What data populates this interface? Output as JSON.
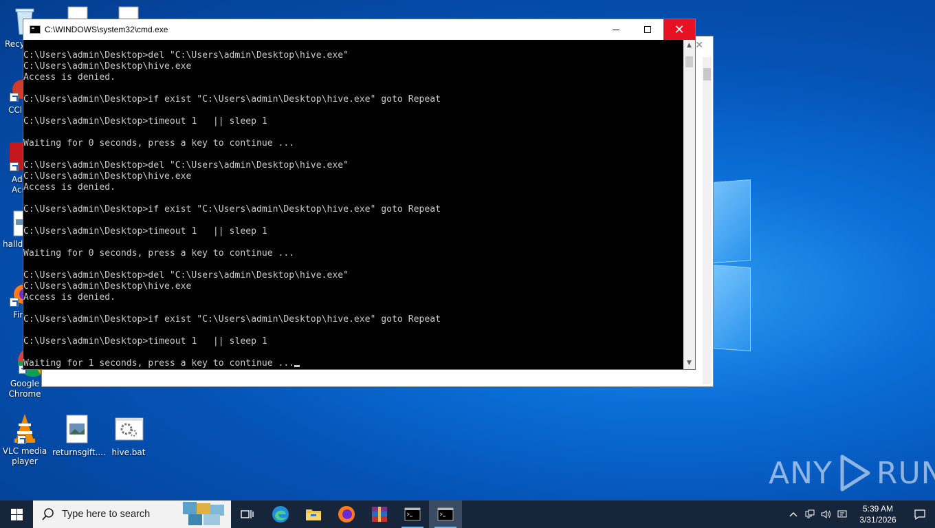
{
  "desktop": {
    "icons": [
      {
        "id": "recycle",
        "label": "Recy"
      },
      {
        "id": "ccleaner",
        "label": "CCl"
      },
      {
        "id": "acrobat",
        "label": "Ad\nAcr"
      },
      {
        "id": "halld",
        "label": "halld"
      },
      {
        "id": "firefox",
        "label": "Fir"
      },
      {
        "id": "chrome",
        "label": "Google\nChrome"
      },
      {
        "id": "vlc",
        "label": "VLC media\nplayer"
      },
      {
        "id": "returnsgift",
        "label": "returnsgift...."
      },
      {
        "id": "hivebat",
        "label": "hive.bat"
      }
    ]
  },
  "cmd": {
    "title": "C:\\WINDOWS\\system32\\cmd.exe",
    "lines": [
      "C:\\Users\\admin\\Desktop>del \"C:\\Users\\admin\\Desktop\\hive.exe\"",
      "C:\\Users\\admin\\Desktop\\hive.exe",
      "Access is denied.",
      "",
      "C:\\Users\\admin\\Desktop>if exist \"C:\\Users\\admin\\Desktop\\hive.exe\" goto Repeat",
      "",
      "C:\\Users\\admin\\Desktop>timeout 1   || sleep 1",
      "",
      "Waiting for 0 seconds, press a key to continue ...",
      "",
      "C:\\Users\\admin\\Desktop>del \"C:\\Users\\admin\\Desktop\\hive.exe\"",
      "C:\\Users\\admin\\Desktop\\hive.exe",
      "Access is denied.",
      "",
      "C:\\Users\\admin\\Desktop>if exist \"C:\\Users\\admin\\Desktop\\hive.exe\" goto Repeat",
      "",
      "C:\\Users\\admin\\Desktop>timeout 1   || sleep 1",
      "",
      "Waiting for 0 seconds, press a key to continue ...",
      "",
      "C:\\Users\\admin\\Desktop>del \"C:\\Users\\admin\\Desktop\\hive.exe\"",
      "C:\\Users\\admin\\Desktop\\hive.exe",
      "Access is denied.",
      "",
      "C:\\Users\\admin\\Desktop>if exist \"C:\\Users\\admin\\Desktop\\hive.exe\" goto Repeat",
      "",
      "C:\\Users\\admin\\Desktop>timeout 1   || sleep 1",
      "",
      "Waiting for 1 seconds, press a key to continue ..."
    ]
  },
  "watermark": {
    "left": "ANY",
    "right": "RUN"
  },
  "taskbar": {
    "search_placeholder": "Type here to search",
    "apps": [
      "task-view",
      "edge",
      "file-explorer",
      "firefox",
      "winrar",
      "cmd",
      "cmd-active"
    ],
    "clock_time": "5:39 AM",
    "clock_date": "3/31/2026"
  },
  "colors": {
    "taskbar": "#17253a",
    "close_red": "#e81123",
    "console_text": "#cccccc"
  }
}
